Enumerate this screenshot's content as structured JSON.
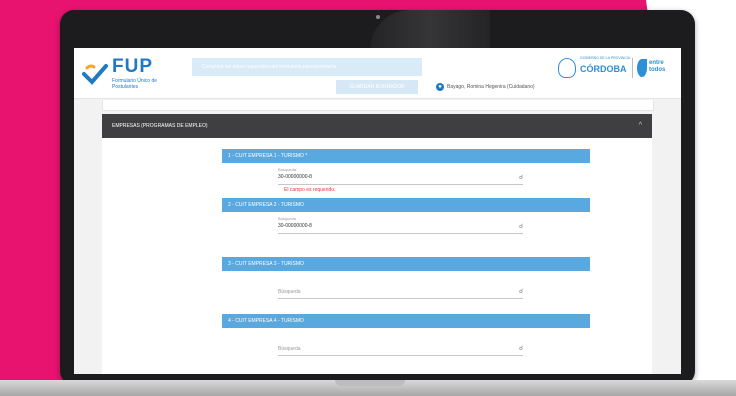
{
  "header": {
    "logo_text": "FUP",
    "logo_sub": "Formulario Único de Postulantes",
    "banner_text": "Completá los datos requeridos del formulario para postularte.",
    "save_label": "GUARDAR BORRADOR",
    "user_name": "Bayago, Romina Hegenira (Cuidadano)",
    "gov_name": "CÓRDOBA",
    "gov_sub": "GOBIERNO DE LA PROVINCIA",
    "gov_ent": "entre todos"
  },
  "section": {
    "title": "EMPRESAS (PROGRAMAS DE EMPLEO)",
    "fields": [
      {
        "bar": "1 - CUIT EMPRESA 1 - TURISMO *",
        "label": "Búsqueda",
        "value": "30-00000000-8",
        "placeholder": "",
        "error": "El campo es requerido."
      },
      {
        "bar": "2 - CUIT EMPRESA 2 - TURISMO",
        "label": "Búsqueda",
        "value": "30-00000000-8",
        "placeholder": "",
        "error": ""
      },
      {
        "bar": "3 - CUIT EMPRESA 3 - TURISMO",
        "label": "",
        "value": "",
        "placeholder": "Búsqueda",
        "error": ""
      },
      {
        "bar": "4 - CUIT EMPRESA 4 - TURISMO",
        "label": "",
        "value": "",
        "placeholder": "Búsqueda",
        "error": ""
      }
    ]
  },
  "colors": {
    "pink": "#e8126f",
    "blue": "#5aa8e0",
    "dark": "#3f3f41"
  }
}
